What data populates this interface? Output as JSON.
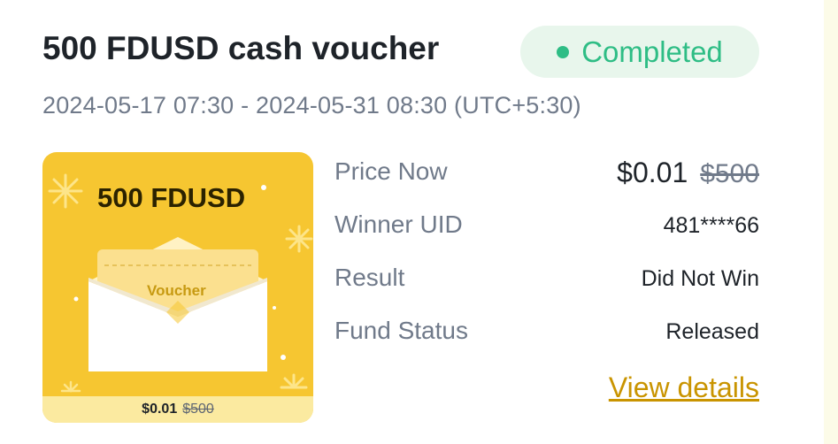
{
  "voucher": {
    "title": "500 FDUSD cash voucher",
    "status": "Completed",
    "period": "2024-05-17 07:30 - 2024-05-31 08:30 (UTC+5:30)"
  },
  "card": {
    "title": "500 FDUSD",
    "envelope_label": "Voucher",
    "price": "$0.01",
    "original_price": "$500"
  },
  "details": {
    "price_now_label": "Price Now",
    "price_now": "$0.01",
    "price_original": "$500",
    "winner_uid_label": "Winner UID",
    "winner_uid": "481****66",
    "result_label": "Result",
    "result": "Did Not Win",
    "fund_status_label": "Fund Status",
    "fund_status": "Released",
    "view_details": "View details"
  },
  "colors": {
    "status_green": "#2ebd85",
    "link_gold": "#c99400",
    "card_yellow": "#f6c631"
  }
}
